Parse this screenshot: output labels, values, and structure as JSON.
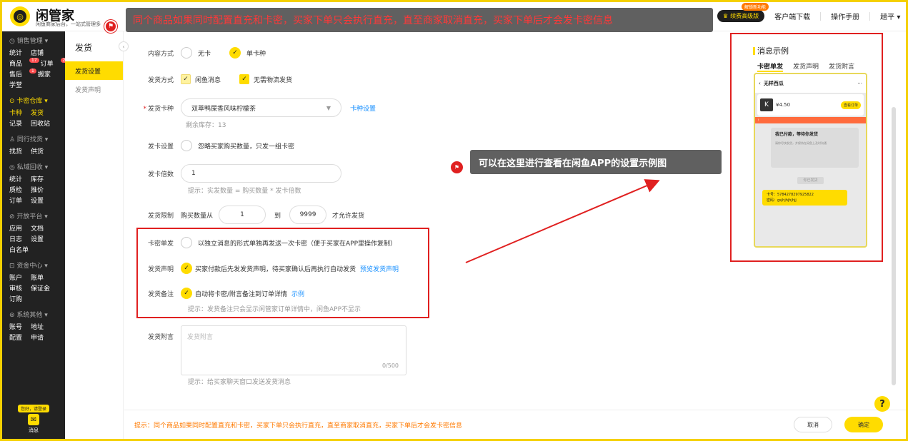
{
  "header": {
    "brand": "闲管家",
    "brand_sub": "闲鱼商家后台，一站式管理多",
    "annotation_top": "同个商品如果同时配置直充和卡密，买家下单只会执行直充，直至商家取消直充，买家下单后才会发卡密信息",
    "vip_label": "续费高级版",
    "vip_new_tag": "解锁新功能",
    "download": "客户端下载",
    "manual": "操作手册",
    "user": "趟平"
  },
  "sidebar": {
    "groups": [
      {
        "title": "销售管理",
        "rows": [
          [
            "统计",
            "店铺"
          ],
          [
            "商品",
            "订单"
          ],
          [
            "售后",
            "搬家"
          ],
          [
            "学堂"
          ]
        ],
        "badges": {
          "商品": "17",
          "订单": "2",
          "售后": "1"
        }
      },
      {
        "title": "卡密仓库",
        "rows": [
          [
            "卡种",
            "发货"
          ],
          [
            "记录",
            "回收站"
          ]
        ]
      },
      {
        "title": "同行找货",
        "rows": [
          [
            "找货",
            "供货"
          ]
        ]
      },
      {
        "title": "私域回收",
        "rows": [
          [
            "统计",
            "库存"
          ],
          [
            "质检",
            "推价"
          ],
          [
            "订单",
            "设置"
          ]
        ]
      },
      {
        "title": "开放平台",
        "rows": [
          [
            "应用",
            "文档"
          ],
          [
            "日志",
            "设置"
          ],
          [
            "白名单"
          ]
        ]
      },
      {
        "title": "资金中心",
        "rows": [
          [
            "账户",
            "账单"
          ],
          [
            "审核",
            "保证金"
          ],
          [
            "订购"
          ]
        ]
      },
      {
        "title": "系统其他",
        "rows": [
          [
            "账号",
            "地址"
          ],
          [
            "配置",
            "申请"
          ]
        ]
      }
    ],
    "login_tag": "您好，请登录",
    "message": "消息"
  },
  "subnav": {
    "title": "发货",
    "items": [
      "发货设置",
      "发货声明"
    ]
  },
  "form": {
    "content_mode_label": "内容方式",
    "content_mode_opt1": "无卡",
    "content_mode_opt2": "单卡种",
    "ship_mode_label": "发货方式",
    "ship_mode_opt1": "闲鱼消息",
    "ship_mode_opt2": "无需物流发货",
    "card_type_label": "发货卡种",
    "card_type_value": "双萃鸭屎香风味柠檬茶",
    "card_type_link": "卡种设置",
    "stock_hint": "剩余库存：13",
    "send_setting_label": "发卡设置",
    "send_setting_opt": "忽略买家购买数量，只发一组卡密",
    "multiple_label": "发卡倍数",
    "multiple_value": "1",
    "multiple_hint": "提示：实发数量 = 购买数量 * 发卡倍数",
    "limit_label": "发货限制",
    "limit_prefix": "购买数量从",
    "limit_from": "1",
    "limit_to_text": "到",
    "limit_to": "9999",
    "limit_suffix": "才允许发货",
    "single_label": "卡密单发",
    "single_opt": "以独立消息的形式单独再发送一次卡密（便于买家在APP里操作复制）",
    "statement_label": "发货声明",
    "statement_opt": "买家付款后先发发货声明，待买家确认后再执行自动发货",
    "statement_link": "预览发货声明",
    "remark_label": "发货备注",
    "remark_opt": "自动将卡密/附言备注到订单详情",
    "remark_link": "示例",
    "remark_hint": "提示：发货备注只会显示闲管家订单详情中，闲鱼APP不显示",
    "attach_label": "发货附言",
    "attach_placeholder": "发货附言",
    "attach_count": "0/500",
    "attach_hint": "提示：给买家聊天窗口发送发货消息"
  },
  "annotation_mid": "可以在这里进行查看在闲鱼APP的设置示例图",
  "preview": {
    "title": "消息示例",
    "tabs": [
      "卡密单发",
      "发货声明",
      "发货附言"
    ],
    "phone": {
      "shop": "无样西瓜",
      "price": "¥4.50",
      "k_logo": "K",
      "view_order": "查看订单",
      "paid_title": "我已付款，等待你发货",
      "paid_sub": "请你尽快发货，并保持在闲鱼上及时沟通",
      "system_tag": "你已发货",
      "card_no": "卡号：5784278297925822",
      "card_pwd": "密码：gsjhjhjhjhjj"
    }
  },
  "footer": {
    "tip": "提示：同个商品如果同时配置直充和卡密，买家下单只会执行直充，直至商家取消直充，买家下单后才会发卡密信息",
    "cancel": "取消",
    "ok": "确定"
  },
  "help": "?",
  "colors": {
    "accent": "#ffdc00",
    "annotation_red": "#e02020",
    "link": "#1890ff",
    "sidebar": "#222222"
  }
}
